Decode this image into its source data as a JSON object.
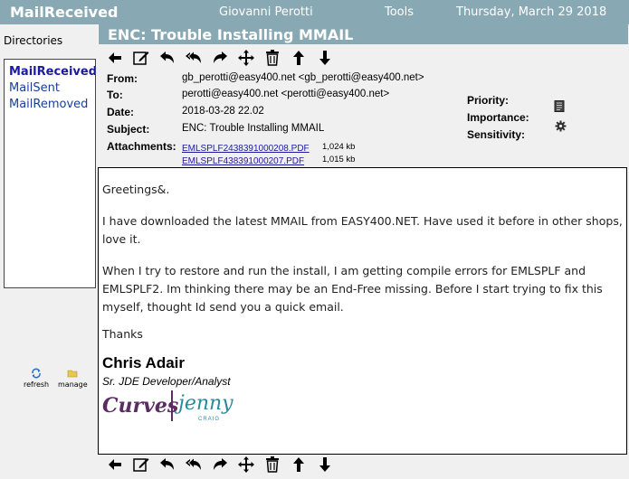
{
  "header": {
    "app_title": "MailReceived",
    "user": "Giovanni Perotti",
    "tools": "Tools",
    "date": "Thursday, March 29 2018"
  },
  "sidebar": {
    "heading": "Directories",
    "directories": [
      {
        "label": "MailReceived",
        "count": "(",
        "selected": true
      },
      {
        "label": "MailSent",
        "count": "",
        "selected": false
      },
      {
        "label": "MailRemoved",
        "count": "",
        "selected": false
      }
    ],
    "refresh_label": "refresh",
    "manage_label": "manage"
  },
  "message": {
    "title": "ENC: Trouble Installing MMAIL",
    "from_label": "From:",
    "from": "gb_perotti@easy400.net <gb_perotti@easy400.net>",
    "to_label": "To:",
    "to": "perotti@easy400.net <perotti@easy400.net>",
    "date_label": "Date:",
    "date": "2018-03-28 22.02",
    "subject_label": "Subject:",
    "subject": "ENC: Trouble Installing MMAIL",
    "attachments_label": "Attachments:",
    "attachments": [
      {
        "name": "EMLSPLF2438391000208.PDF",
        "size": "1,024 kb"
      },
      {
        "name": "EMLSPLF438391000207.PDF",
        "size": "1,015 kb"
      }
    ],
    "priority_label": "Priority:",
    "importance_label": "Importance:",
    "sensitivity_label": "Sensitivity:",
    "body": {
      "greeting": "Greetings&.",
      "para1": "I have downloaded the latest MMAIL from EASY400.NET. Have used it before in other shops, love it.",
      "para2": "When I try to restore and run the install, I am getting compile errors for EMLSPLF and EMLSPLF2. Im thinking there may be an End-Free missing. Before I start trying to fix this myself, thought Id send you a quick email.",
      "thanks": "Thanks",
      "sig_name": "Chris Adair",
      "sig_title": "Sr. JDE Developer/Analyst",
      "logo_left": "Curves",
      "logo_right": "jenny",
      "logo_small": "CRAIG"
    }
  },
  "toolbar_icons": [
    "back-arrow-icon",
    "edit-icon",
    "reply-icon",
    "reply-all-icon",
    "forward-icon",
    "move-icon",
    "trash-icon",
    "arrow-up-icon",
    "arrow-down-icon"
  ]
}
